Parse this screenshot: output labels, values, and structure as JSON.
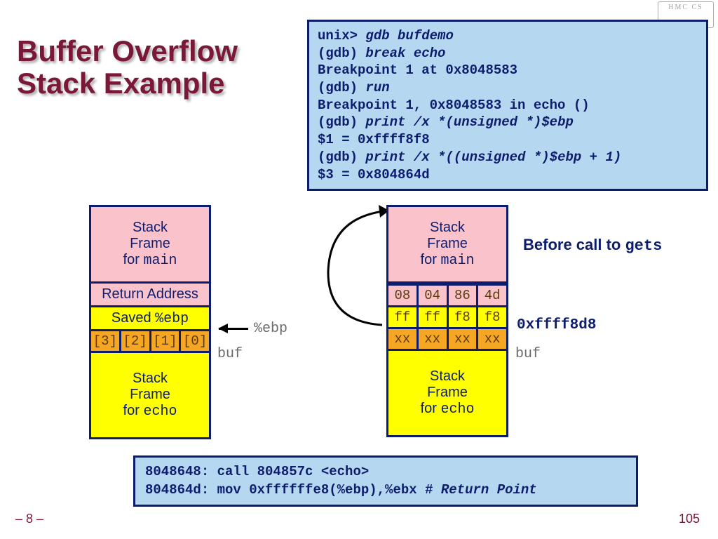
{
  "title_line1": "Buffer Overflow",
  "title_line2": "Stack Example",
  "gdb": {
    "l1a": "unix> ",
    "l1b": "gdb bufdemo",
    "l2a": "(gdb) ",
    "l2b": "break echo",
    "l3": "Breakpoint 1 at 0x8048583",
    "l4a": "(gdb) ",
    "l4b": "run",
    "l5": "Breakpoint 1, 0x8048583 in echo ()",
    "l6a": "(gdb) ",
    "l6b": "print /x *(unsigned *)$ebp",
    "l7": "$1 = 0xffff8f8",
    "l8a": "(gdb) ",
    "l8b": "print /x *((unsigned *)$ebp + 1)",
    "l9": "$3 = 0x804864d"
  },
  "stack_left": {
    "main_l1": "Stack",
    "main_l2": "Frame",
    "main_l3_a": "for ",
    "main_l3_b": "main",
    "ret": "Return Address",
    "ebp_a": "Saved ",
    "ebp_b": "%ebp",
    "buf": [
      "[3]",
      "[2]",
      "[1]",
      "[0]"
    ],
    "echo_l1": "Stack",
    "echo_l2": "Frame",
    "echo_l3_a": "for ",
    "echo_l3_b": "echo"
  },
  "stack_right": {
    "main_l1": "Stack",
    "main_l2": "Frame",
    "main_l3_a": "for ",
    "main_l3_b": "main",
    "ret_bytes": [
      "08",
      "04",
      "86",
      "4d"
    ],
    "ebp_bytes": [
      "ff",
      "ff",
      "f8",
      "f8"
    ],
    "buf_bytes": [
      "xx",
      "xx",
      "xx",
      "xx"
    ],
    "echo_l1": "Stack",
    "echo_l2": "Frame",
    "echo_l3_a": "for ",
    "echo_l3_b": "echo"
  },
  "labels": {
    "ebp": "%ebp",
    "buf": "buf",
    "before_a": "Before call to ",
    "before_b": "gets",
    "addr": "0xffff8d8"
  },
  "asm": {
    "l1": "8048648:  call 804857c <echo>",
    "l2a": "804864d:  mov  0xffffffe8(%ebp),%ebx # ",
    "l2b": "Return Point"
  },
  "footer": {
    "left": "– 8 –",
    "right": "105"
  },
  "logo": "HMC  CS"
}
